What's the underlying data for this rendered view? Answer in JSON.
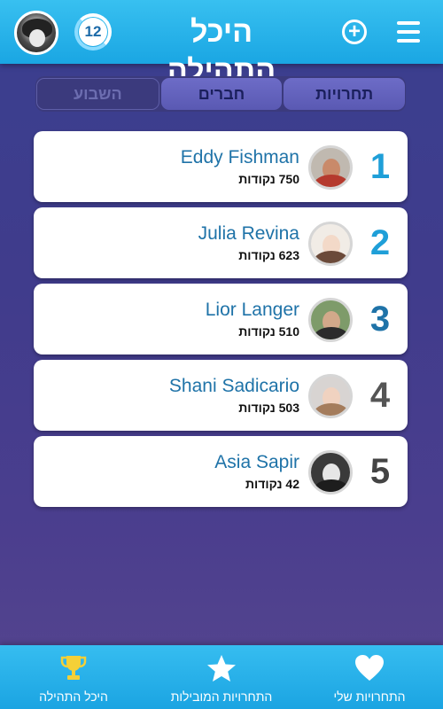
{
  "header": {
    "title": "היכל התהילה",
    "level": "12"
  },
  "tabs": [
    {
      "label": "תחרויות",
      "state": "normal"
    },
    {
      "label": "חברים",
      "state": "active"
    },
    {
      "label": "השבוע",
      "state": "disabled"
    }
  ],
  "leaderboard": [
    {
      "rank": "1",
      "name": "Eddy Fishman",
      "points": "750 נקודות",
      "rank_color": "#1f9fd8"
    },
    {
      "rank": "2",
      "name": "Julia Revina",
      "points": "623 נקודות",
      "rank_color": "#1f9fd8"
    },
    {
      "rank": "3",
      "name": "Lior Langer",
      "points": "510 נקודות",
      "rank_color": "#1f73a8"
    },
    {
      "rank": "4",
      "name": "Shani Sadicario",
      "points": "503 נקודות",
      "rank_color": "#555555"
    },
    {
      "rank": "5",
      "name": "Asia Sapir",
      "points": "42 נקודות",
      "rank_color": "#444444"
    }
  ],
  "bottom_nav": [
    {
      "label": "התחרויות שלי",
      "icon": "heart-icon"
    },
    {
      "label": "התחרויות המובילות",
      "icon": "star-icon"
    },
    {
      "label": "היכל התהילה",
      "icon": "trophy-icon"
    }
  ],
  "colors": {
    "accent": "#1aa6e3",
    "background": "#403c8c",
    "name_text": "#1f73a8"
  }
}
